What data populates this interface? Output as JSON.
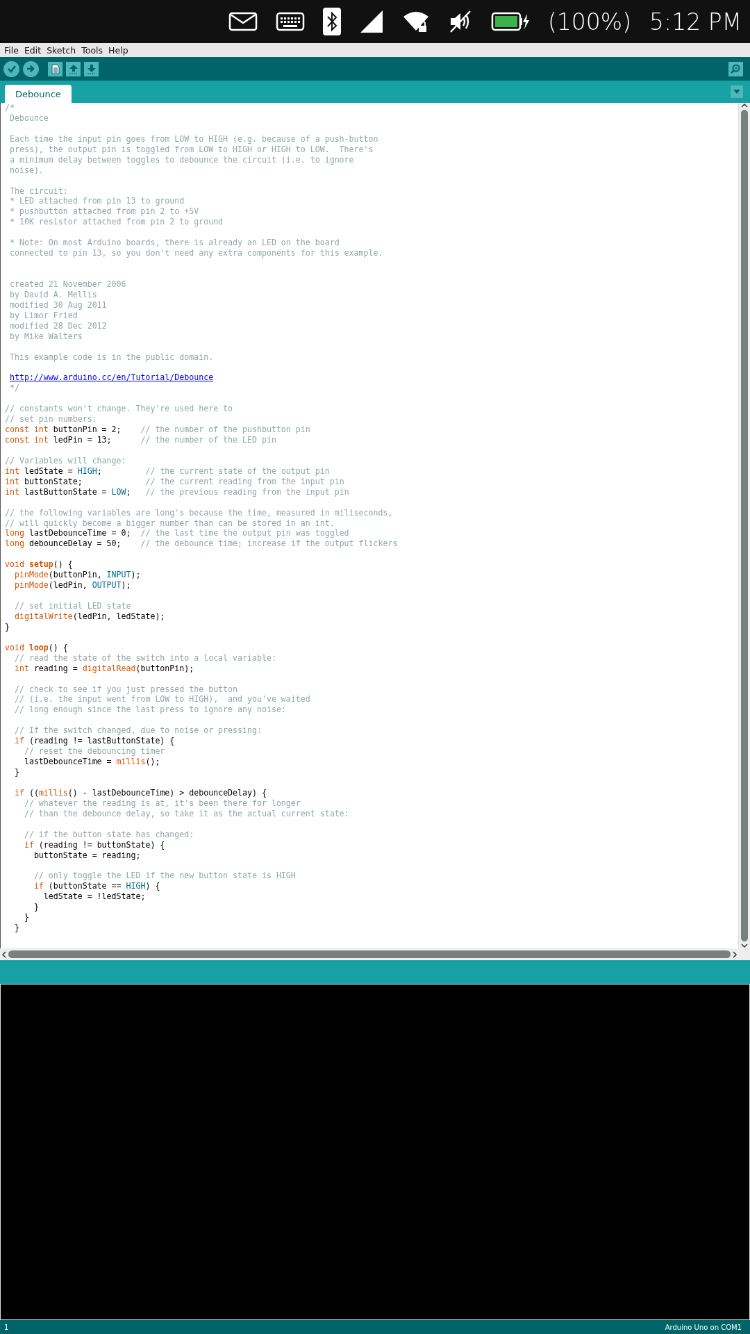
{
  "status_bar": {
    "battery": "(100%)",
    "time": "5:12 PM"
  },
  "menu": [
    "File",
    "Edit",
    "Sketch",
    "Tools",
    "Help"
  ],
  "tabs": [
    {
      "label": "Debounce",
      "selected": true
    }
  ],
  "code": [
    {
      "kind": "code",
      "segments": [
        {
          "kind": "comment",
          "text": "/*"
        }
      ]
    },
    {
      "kind": "code",
      "segments": [
        {
          "kind": "comment",
          "text": " Debounce"
        }
      ]
    },
    {
      "kind": "blank"
    },
    {
      "kind": "code",
      "segments": [
        {
          "kind": "comment",
          "text": " Each time the input pin goes from LOW to HIGH (e.g. because of a push-button"
        }
      ]
    },
    {
      "kind": "code",
      "segments": [
        {
          "kind": "comment",
          "text": " press), the output pin is toggled from LOW to HIGH or HIGH to LOW.  There's"
        }
      ]
    },
    {
      "kind": "code",
      "segments": [
        {
          "kind": "comment",
          "text": " a minimum delay between toggles to debounce the circuit (i.e. to ignore"
        }
      ]
    },
    {
      "kind": "code",
      "segments": [
        {
          "kind": "comment",
          "text": " noise)."
        }
      ]
    },
    {
      "kind": "blank"
    },
    {
      "kind": "code",
      "segments": [
        {
          "kind": "comment",
          "text": " The circuit:"
        }
      ]
    },
    {
      "kind": "code",
      "segments": [
        {
          "kind": "comment",
          "text": " * LED attached from pin 13 to ground"
        }
      ]
    },
    {
      "kind": "code",
      "segments": [
        {
          "kind": "comment",
          "text": " * pushbutton attached from pin 2 to +5V"
        }
      ]
    },
    {
      "kind": "code",
      "segments": [
        {
          "kind": "comment",
          "text": " * 10K resistor attached from pin 2 to ground"
        }
      ]
    },
    {
      "kind": "blank"
    },
    {
      "kind": "code",
      "segments": [
        {
          "kind": "comment",
          "text": " * Note: On most Arduino boards, there is already an LED on the board"
        }
      ]
    },
    {
      "kind": "code",
      "segments": [
        {
          "kind": "comment",
          "text": " connected to pin 13, so you don't need any extra components for this example."
        }
      ]
    },
    {
      "kind": "blank"
    },
    {
      "kind": "blank"
    },
    {
      "kind": "code",
      "segments": [
        {
          "kind": "comment",
          "text": " created 21 November 2006"
        }
      ]
    },
    {
      "kind": "code",
      "segments": [
        {
          "kind": "comment",
          "text": " by David A. Mellis"
        }
      ]
    },
    {
      "kind": "code",
      "segments": [
        {
          "kind": "comment",
          "text": " modified 30 Aug 2011"
        }
      ]
    },
    {
      "kind": "code",
      "segments": [
        {
          "kind": "comment",
          "text": " by Limor Fried"
        }
      ]
    },
    {
      "kind": "code",
      "segments": [
        {
          "kind": "comment",
          "text": " modified 28 Dec 2012"
        }
      ]
    },
    {
      "kind": "code",
      "segments": [
        {
          "kind": "comment",
          "text": " by Mike Walters"
        }
      ]
    },
    {
      "kind": "blank"
    },
    {
      "kind": "code",
      "segments": [
        {
          "kind": "comment",
          "text": " This example code is in the public domain."
        }
      ]
    },
    {
      "kind": "blank"
    },
    {
      "kind": "code",
      "segments": [
        {
          "kind": "link",
          "text": "http://www.arduino.cc/en/Tutorial/Debounce"
        }
      ]
    },
    {
      "kind": "code",
      "segments": [
        {
          "kind": "comment",
          "text": " */"
        }
      ]
    },
    {
      "kind": "blank"
    },
    {
      "kind": "code",
      "segments": [
        {
          "kind": "comment",
          "text": "// constants won't change. They're used here to"
        }
      ]
    },
    {
      "kind": "code",
      "segments": [
        {
          "kind": "comment",
          "text": "// set pin numbers:"
        }
      ]
    },
    {
      "kind": "code",
      "segments": [
        {
          "kind": "keyword",
          "text": "const int"
        },
        {
          "kind": "plain",
          "text": " buttonPin = 2;    "
        },
        {
          "kind": "comment",
          "text": "// the number of the pushbutton pin"
        }
      ]
    },
    {
      "kind": "code",
      "segments": [
        {
          "kind": "keyword",
          "text": "const int"
        },
        {
          "kind": "plain",
          "text": " ledPin = 13;      "
        },
        {
          "kind": "comment",
          "text": "// the number of the LED pin"
        }
      ]
    },
    {
      "kind": "blank"
    },
    {
      "kind": "code",
      "segments": [
        {
          "kind": "comment",
          "text": "// Variables will change:"
        }
      ]
    },
    {
      "kind": "code",
      "segments": [
        {
          "kind": "keyword",
          "text": "int"
        },
        {
          "kind": "plain",
          "text": " ledState = "
        },
        {
          "kind": "constant",
          "text": "HIGH"
        },
        {
          "kind": "plain",
          "text": ";         "
        },
        {
          "kind": "comment",
          "text": "// the current state of the output pin"
        }
      ]
    },
    {
      "kind": "code",
      "segments": [
        {
          "kind": "keyword",
          "text": "int"
        },
        {
          "kind": "plain",
          "text": " buttonState;             "
        },
        {
          "kind": "comment",
          "text": "// the current reading from the input pin"
        }
      ]
    },
    {
      "kind": "code",
      "segments": [
        {
          "kind": "keyword",
          "text": "int"
        },
        {
          "kind": "plain",
          "text": " lastButtonState = "
        },
        {
          "kind": "constant",
          "text": "LOW"
        },
        {
          "kind": "plain",
          "text": ";   "
        },
        {
          "kind": "comment",
          "text": "// the previous reading from the input pin"
        }
      ]
    },
    {
      "kind": "blank"
    },
    {
      "kind": "code",
      "segments": [
        {
          "kind": "comment",
          "text": "// the following variables are long's because the time, measured in miliseconds,"
        }
      ]
    },
    {
      "kind": "code",
      "segments": [
        {
          "kind": "comment",
          "text": "// will quickly become a bigger number than can be stored in an int."
        }
      ]
    },
    {
      "kind": "code",
      "segments": [
        {
          "kind": "keyword",
          "text": "long"
        },
        {
          "kind": "plain",
          "text": " lastDebounceTime = 0;  "
        },
        {
          "kind": "comment",
          "text": "// the last time the output pin was toggled"
        }
      ]
    },
    {
      "kind": "code",
      "segments": [
        {
          "kind": "keyword",
          "text": "long"
        },
        {
          "kind": "plain",
          "text": " debounceDelay = 50;    "
        },
        {
          "kind": "comment",
          "text": "// the debounce time; increase if the output flickers"
        }
      ]
    },
    {
      "kind": "blank"
    },
    {
      "kind": "code",
      "segments": [
        {
          "kind": "keyword",
          "text": "void"
        },
        {
          "kind": "name",
          "text": " setup"
        },
        {
          "kind": "plain",
          "text": "() {"
        }
      ]
    },
    {
      "kind": "code",
      "segments": [
        {
          "kind": "keyword",
          "text": "  pinMode"
        },
        {
          "kind": "plain",
          "text": "(buttonPin, "
        },
        {
          "kind": "constant",
          "text": "INPUT"
        },
        {
          "kind": "plain",
          "text": ");"
        }
      ]
    },
    {
      "kind": "code",
      "segments": [
        {
          "kind": "keyword",
          "text": "  pinMode"
        },
        {
          "kind": "plain",
          "text": "(ledPin, "
        },
        {
          "kind": "constant",
          "text": "OUTPUT"
        },
        {
          "kind": "plain",
          "text": ");"
        }
      ]
    },
    {
      "kind": "blank"
    },
    {
      "kind": "code",
      "segments": [
        {
          "kind": "comment",
          "text": "  // set initial LED state"
        }
      ]
    },
    {
      "kind": "code",
      "segments": [
        {
          "kind": "keyword",
          "text": "  digitalWrite"
        },
        {
          "kind": "plain",
          "text": "(ledPin, ledState);"
        }
      ]
    },
    {
      "kind": "code",
      "segments": [
        {
          "kind": "plain",
          "text": "}"
        }
      ]
    },
    {
      "kind": "blank"
    },
    {
      "kind": "code",
      "segments": [
        {
          "kind": "keyword",
          "text": "void"
        },
        {
          "kind": "name",
          "text": " loop"
        },
        {
          "kind": "plain",
          "text": "() {"
        }
      ]
    },
    {
      "kind": "code",
      "segments": [
        {
          "kind": "comment",
          "text": "  // read the state of the switch into a local variable:"
        }
      ]
    },
    {
      "kind": "code",
      "segments": [
        {
          "kind": "keyword",
          "text": "  int"
        },
        {
          "kind": "plain",
          "text": " reading = "
        },
        {
          "kind": "keyword",
          "text": "digitalRead"
        },
        {
          "kind": "plain",
          "text": "(buttonPin);"
        }
      ]
    },
    {
      "kind": "blank"
    },
    {
      "kind": "code",
      "segments": [
        {
          "kind": "comment",
          "text": "  // check to see if you just pressed the button"
        }
      ]
    },
    {
      "kind": "code",
      "segments": [
        {
          "kind": "comment",
          "text": "  // (i.e. the input went from LOW to HIGH),  and you've waited"
        }
      ]
    },
    {
      "kind": "code",
      "segments": [
        {
          "kind": "comment",
          "text": "  // long enough since the last press to ignore any noise:"
        }
      ]
    },
    {
      "kind": "blank"
    },
    {
      "kind": "code",
      "segments": [
        {
          "kind": "comment",
          "text": "  // If the switch changed, due to noise or pressing:"
        }
      ]
    },
    {
      "kind": "code",
      "segments": [
        {
          "kind": "keyword",
          "text": "  if"
        },
        {
          "kind": "plain",
          "text": " (reading != lastButtonState) {"
        }
      ]
    },
    {
      "kind": "code",
      "segments": [
        {
          "kind": "comment",
          "text": "    // reset the debouncing timer"
        }
      ]
    },
    {
      "kind": "code",
      "segments": [
        {
          "kind": "plain",
          "text": "    lastDebounceTime = "
        },
        {
          "kind": "keyword",
          "text": "millis"
        },
        {
          "kind": "plain",
          "text": "();"
        }
      ]
    },
    {
      "kind": "code",
      "segments": [
        {
          "kind": "plain",
          "text": "  }"
        }
      ]
    },
    {
      "kind": "blank"
    },
    {
      "kind": "code",
      "segments": [
        {
          "kind": "keyword",
          "text": "  if"
        },
        {
          "kind": "plain",
          "text": " (("
        },
        {
          "kind": "keyword",
          "text": "millis"
        },
        {
          "kind": "plain",
          "text": "() - lastDebounceTime) > debounceDelay) {"
        }
      ]
    },
    {
      "kind": "code",
      "segments": [
        {
          "kind": "comment",
          "text": "    // whatever the reading is at, it's been there for longer"
        }
      ]
    },
    {
      "kind": "code",
      "segments": [
        {
          "kind": "comment",
          "text": "    // than the debounce delay, so take it as the actual current state:"
        }
      ]
    },
    {
      "kind": "blank"
    },
    {
      "kind": "code",
      "segments": [
        {
          "kind": "comment",
          "text": "    // if the button state has changed:"
        }
      ]
    },
    {
      "kind": "code",
      "segments": [
        {
          "kind": "keyword",
          "text": "    if"
        },
        {
          "kind": "plain",
          "text": " (reading != buttonState) {"
        }
      ]
    },
    {
      "kind": "code",
      "segments": [
        {
          "kind": "plain",
          "text": "      buttonState = reading;"
        }
      ]
    },
    {
      "kind": "blank"
    },
    {
      "kind": "code",
      "segments": [
        {
          "kind": "comment",
          "text": "      // only toggle the LED if the new button state is HIGH"
        }
      ]
    },
    {
      "kind": "code",
      "segments": [
        {
          "kind": "keyword",
          "text": "      if"
        },
        {
          "kind": "plain",
          "text": " (buttonState == "
        },
        {
          "kind": "constant",
          "text": "HIGH"
        },
        {
          "kind": "plain",
          "text": ") {"
        }
      ]
    },
    {
      "kind": "code",
      "segments": [
        {
          "kind": "plain",
          "text": "        ledState = !ledState;"
        }
      ]
    },
    {
      "kind": "code",
      "segments": [
        {
          "kind": "plain",
          "text": "      }"
        }
      ]
    },
    {
      "kind": "code",
      "segments": [
        {
          "kind": "plain",
          "text": "    }"
        }
      ]
    },
    {
      "kind": "code",
      "segments": [
        {
          "kind": "plain",
          "text": "  }"
        }
      ]
    }
  ],
  "footer": {
    "line": "1",
    "board": "Arduino Uno on COM1"
  }
}
